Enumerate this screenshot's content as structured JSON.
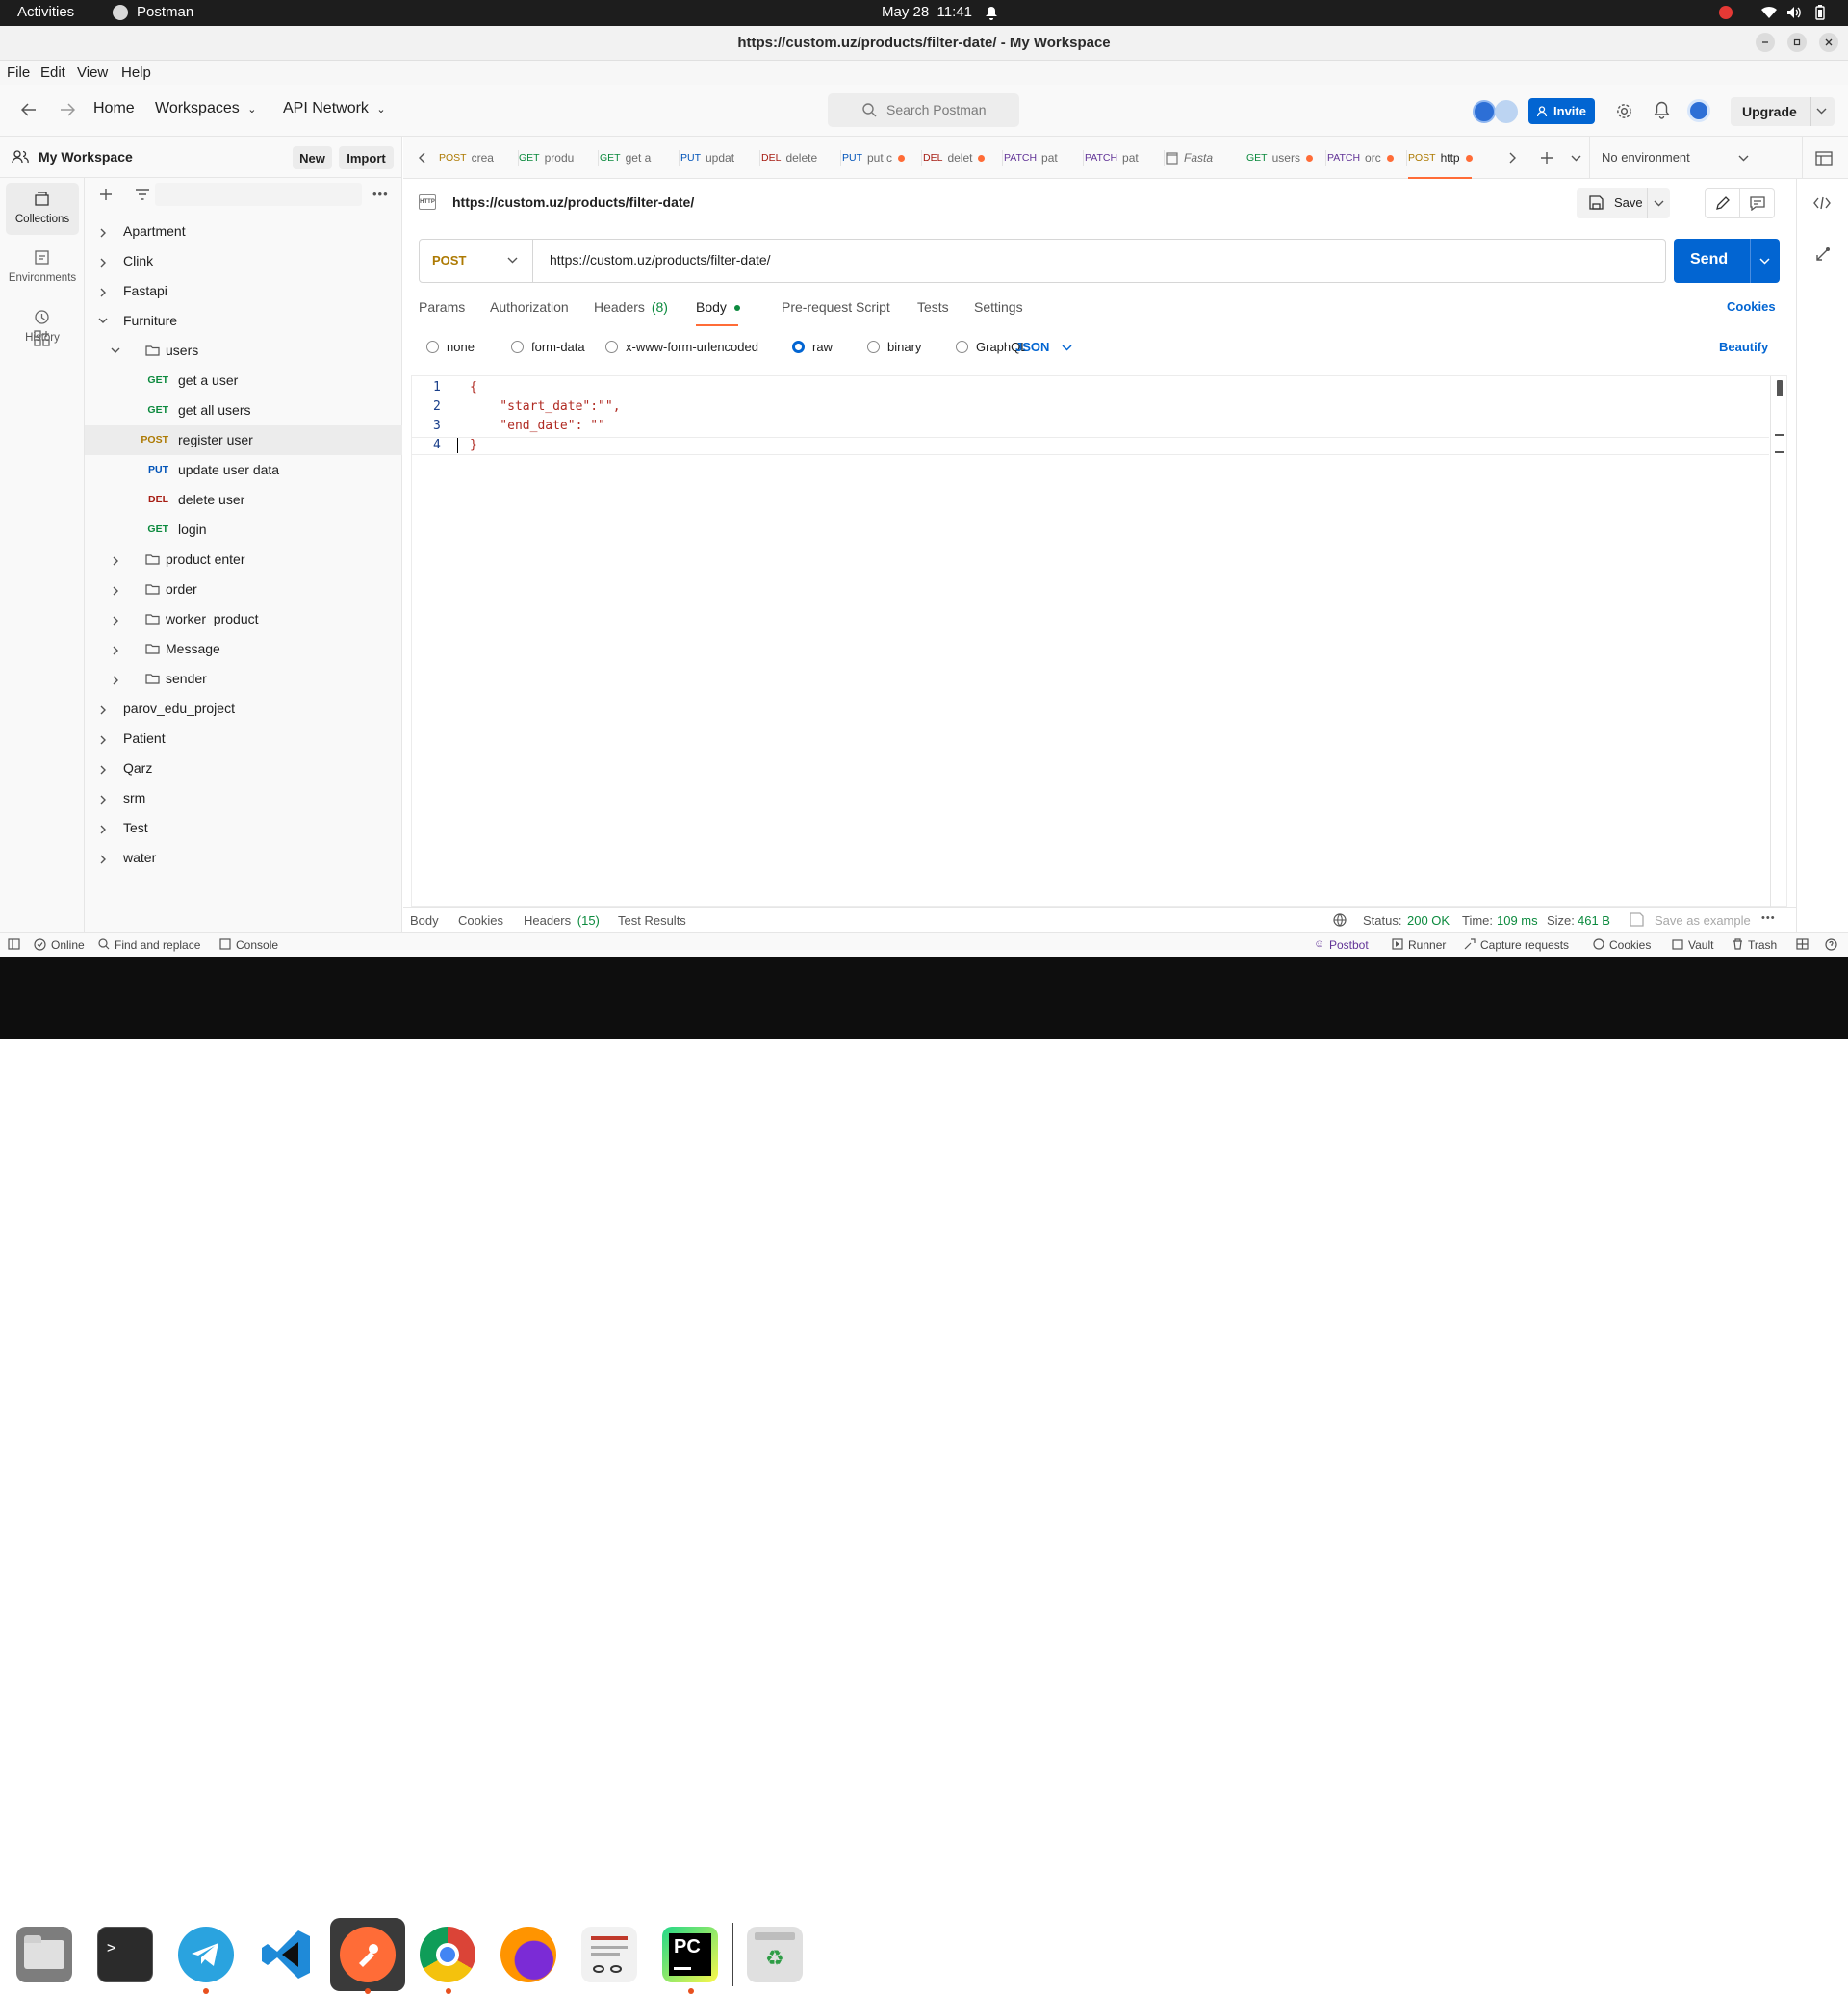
{
  "topbar": {
    "activities": "Activities",
    "app_name": "Postman",
    "datetime": "May 28  11:41"
  },
  "window": {
    "title": "https://custom.uz/products/filter-date/ - My Workspace"
  },
  "menu": [
    "File",
    "Edit",
    "View",
    "Help"
  ],
  "header": {
    "home": "Home",
    "workspaces": "Workspaces",
    "api_network": "API Network",
    "search_placeholder": "Search Postman",
    "invite": "Invite",
    "upgrade": "Upgrade"
  },
  "workspace": {
    "name": "My Workspace",
    "new_label": "New",
    "import_label": "Import"
  },
  "rail": [
    {
      "label": "Collections",
      "icon": "collections-icon"
    },
    {
      "label": "Environments",
      "icon": "environments-icon"
    },
    {
      "label": "History",
      "icon": "history-icon"
    }
  ],
  "tree": [
    {
      "label": "Apartment",
      "depth": 0,
      "kind": "collection"
    },
    {
      "label": "Clink",
      "depth": 0,
      "kind": "collection"
    },
    {
      "label": "Fastapi",
      "depth": 0,
      "kind": "collection"
    },
    {
      "label": "Furniture",
      "depth": 0,
      "kind": "collection",
      "open": true
    },
    {
      "label": "users",
      "depth": 1,
      "kind": "folder",
      "open": true
    },
    {
      "label": "get a user",
      "depth": 2,
      "kind": "request",
      "method": "GET"
    },
    {
      "label": "get all users",
      "depth": 2,
      "kind": "request",
      "method": "GET"
    },
    {
      "label": "register user",
      "depth": 2,
      "kind": "request",
      "method": "POST",
      "selected": true
    },
    {
      "label": "update user data",
      "depth": 2,
      "kind": "request",
      "method": "PUT"
    },
    {
      "label": "delete user",
      "depth": 2,
      "kind": "request",
      "method": "DEL"
    },
    {
      "label": "login",
      "depth": 2,
      "kind": "request",
      "method": "GET"
    },
    {
      "label": "product enter",
      "depth": 1,
      "kind": "folder"
    },
    {
      "label": "order",
      "depth": 1,
      "kind": "folder"
    },
    {
      "label": "worker_product",
      "depth": 1,
      "kind": "folder"
    },
    {
      "label": "Message",
      "depth": 1,
      "kind": "folder"
    },
    {
      "label": "sender",
      "depth": 1,
      "kind": "folder"
    },
    {
      "label": "parov_edu_project",
      "depth": 0,
      "kind": "collection"
    },
    {
      "label": "Patient",
      "depth": 0,
      "kind": "collection"
    },
    {
      "label": "Qarz",
      "depth": 0,
      "kind": "collection"
    },
    {
      "label": "srm",
      "depth": 0,
      "kind": "collection"
    },
    {
      "label": "Test",
      "depth": 0,
      "kind": "collection"
    },
    {
      "label": "water",
      "depth": 0,
      "kind": "collection"
    }
  ],
  "method_colors": {
    "GET": "#0c8a3e",
    "POST": "#ad7a03",
    "PUT": "#0053b8",
    "DEL": "#a61c12",
    "PATCH": "#623497"
  },
  "tabs": [
    {
      "method": "POST",
      "label": "crea",
      "dot": false
    },
    {
      "method": "GET",
      "label": "produ",
      "dot": false
    },
    {
      "method": "GET",
      "label": "get a",
      "dot": false
    },
    {
      "method": "PUT",
      "label": "updat",
      "dot": false
    },
    {
      "method": "DEL",
      "label": "delete",
      "dot": false
    },
    {
      "method": "PUT",
      "label": "put c",
      "dot": true
    },
    {
      "method": "DEL",
      "label": "delet",
      "dot": true
    },
    {
      "method": "PATCH",
      "label": "pat",
      "dot": false
    },
    {
      "method": "PATCH",
      "label": "pat",
      "dot": false
    },
    {
      "method": "",
      "label": "Fasta",
      "dot": false,
      "italic": true
    },
    {
      "method": "GET",
      "label": "users",
      "dot": true
    },
    {
      "method": "PATCH",
      "label": "orc",
      "dot": true
    },
    {
      "method": "POST",
      "label": "http",
      "dot": true,
      "active": true
    }
  ],
  "environment": "No environment",
  "request": {
    "url_title": "https://custom.uz/products/filter-date/",
    "save": "Save",
    "method": "POST",
    "url": "https://custom.uz/products/filter-date/",
    "send": "Send",
    "subtabs": [
      "Params",
      "Authorization",
      "Headers",
      "Body",
      "Pre-request Script",
      "Tests",
      "Settings"
    ],
    "headers_count": "(8)",
    "cookies": "Cookies",
    "body_types": [
      "none",
      "form-data",
      "x-www-form-urlencoded",
      "raw",
      "binary",
      "GraphQL"
    ],
    "selected_body": "raw",
    "format": "JSON",
    "beautify": "Beautify",
    "code": [
      {
        "n": "1",
        "text": "{"
      },
      {
        "n": "2",
        "text": "    \"start_date\":\"\","
      },
      {
        "n": "3",
        "text": "    \"end_date\": \"\""
      },
      {
        "n": "4",
        "text": "}"
      }
    ]
  },
  "response": {
    "tabs": [
      "Body",
      "Cookies",
      "Headers",
      "Test Results"
    ],
    "headers_count": "(15)",
    "status_label": "Status:",
    "status": "200 OK",
    "time_label": "Time:",
    "time": "109 ms",
    "size_label": "Size:",
    "size": "461 B",
    "save_example": "Save as example"
  },
  "statusbar": {
    "online": "Online",
    "find": "Find and replace",
    "console": "Console",
    "postbot": "Postbot",
    "runner": "Runner",
    "capture": "Capture requests",
    "cookies": "Cookies",
    "vault": "Vault",
    "trash": "Trash"
  },
  "dock": [
    {
      "name": "files",
      "icon": "files-icon",
      "running": false
    },
    {
      "name": "terminal",
      "icon": "terminal-icon",
      "running": false
    },
    {
      "name": "telegram",
      "icon": "telegram-icon",
      "running": true
    },
    {
      "name": "vscode",
      "icon": "vscode-icon",
      "running": false
    },
    {
      "name": "postman",
      "icon": "postman-icon",
      "running": true
    },
    {
      "name": "chrome",
      "icon": "chrome-icon",
      "running": true
    },
    {
      "name": "firefox",
      "icon": "firefox-icon",
      "running": false
    },
    {
      "name": "document-viewer",
      "icon": "document-viewer-icon",
      "running": false
    },
    {
      "name": "pycharm",
      "icon": "pycharm-icon",
      "running": true
    },
    {
      "name": "trash",
      "icon": "trash-icon",
      "running": false
    }
  ]
}
